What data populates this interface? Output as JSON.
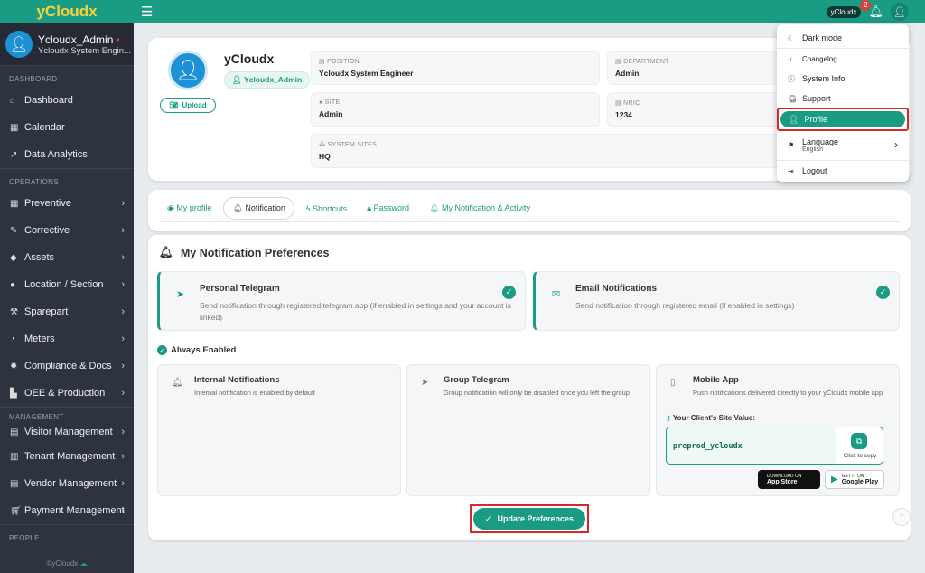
{
  "app": {
    "brand": "yCloudx",
    "pill": "yCloudx",
    "notif_count": "2"
  },
  "sidebar": {
    "user_name": "Ycloudx_Admin",
    "user_role": "Ycloudx System Engin...",
    "sections": {
      "dashboard": "DASHBOARD",
      "operations": "OPERATIONS",
      "management": "MANAGEMENT",
      "people": "PEOPLE"
    },
    "items": [
      {
        "label": "Dashboard"
      },
      {
        "label": "Calendar"
      },
      {
        "label": "Data Analytics"
      },
      {
        "label": "Preventive"
      },
      {
        "label": "Corrective"
      },
      {
        "label": "Assets"
      },
      {
        "label": "Location / Section"
      },
      {
        "label": "Sparepart"
      },
      {
        "label": "Meters"
      },
      {
        "label": "Compliance & Docs"
      },
      {
        "label": "OEE & Production"
      },
      {
        "label": "Visitor Management"
      },
      {
        "label": "Tenant Management"
      },
      {
        "label": "Vendor Management"
      },
      {
        "label": "Payment Management"
      }
    ],
    "footer": "©yCloudx"
  },
  "profile": {
    "name": "yCloudx",
    "tag": "Ycloudx_Admin",
    "upload": "Upload",
    "fields": {
      "position": {
        "label": "POSITION",
        "value": "Ycloudx System Engineer"
      },
      "department": {
        "label": "DEPARTMENT",
        "value": "Admin"
      },
      "site": {
        "label": "SITE",
        "value": "Admin"
      },
      "nric": {
        "label": "NRIC",
        "value": "1234"
      },
      "system_sites": {
        "label": "SYSTEM SITES",
        "value": "HQ"
      }
    }
  },
  "tabs": [
    {
      "label": "My profile"
    },
    {
      "label": "Notification"
    },
    {
      "label": "Shortcuts"
    },
    {
      "label": "Password"
    },
    {
      "label": "My Notification & Activity"
    }
  ],
  "prefs": {
    "title": "My Notification Preferences",
    "telegram": {
      "title": "Personal Telegram",
      "desc": "Send notification through registered telegram app (if enabled in settings and your account is linked)"
    },
    "email": {
      "title": "Email Notifications",
      "desc": "Send notification through registered email (if enabled in settings)"
    },
    "always_label": "Always Enabled",
    "internal": {
      "title": "Internal Notifications",
      "desc": "Internal notification is enabled by default"
    },
    "group": {
      "title": "Group Telegram",
      "desc": "Group notification will only be disabled once you left the group"
    },
    "mobile": {
      "title": "Mobile App",
      "desc": "Push notifications delivered directly to your yCloudx mobile app"
    },
    "site_label": "Your Client's Site Value:",
    "site_value": "preprod_ycloudx",
    "copy_label": "Click to copy",
    "appstore_small": "DOWNLOAD ON",
    "appstore_big": "App Store",
    "google_small": "GET IT ON",
    "google_big": "Google Play",
    "update_button": "Update Preferences"
  },
  "dropdown": {
    "dark_mode": "Dark mode",
    "changelog": "Changelog",
    "system_info": "System Info",
    "support": "Support",
    "profile": "Profile",
    "language": "Language",
    "language_value": "English",
    "logout": "Logout"
  },
  "colors": {
    "accent": "#1a9b83",
    "sidebar": "#2e3340",
    "highlight": "#d8262b"
  }
}
